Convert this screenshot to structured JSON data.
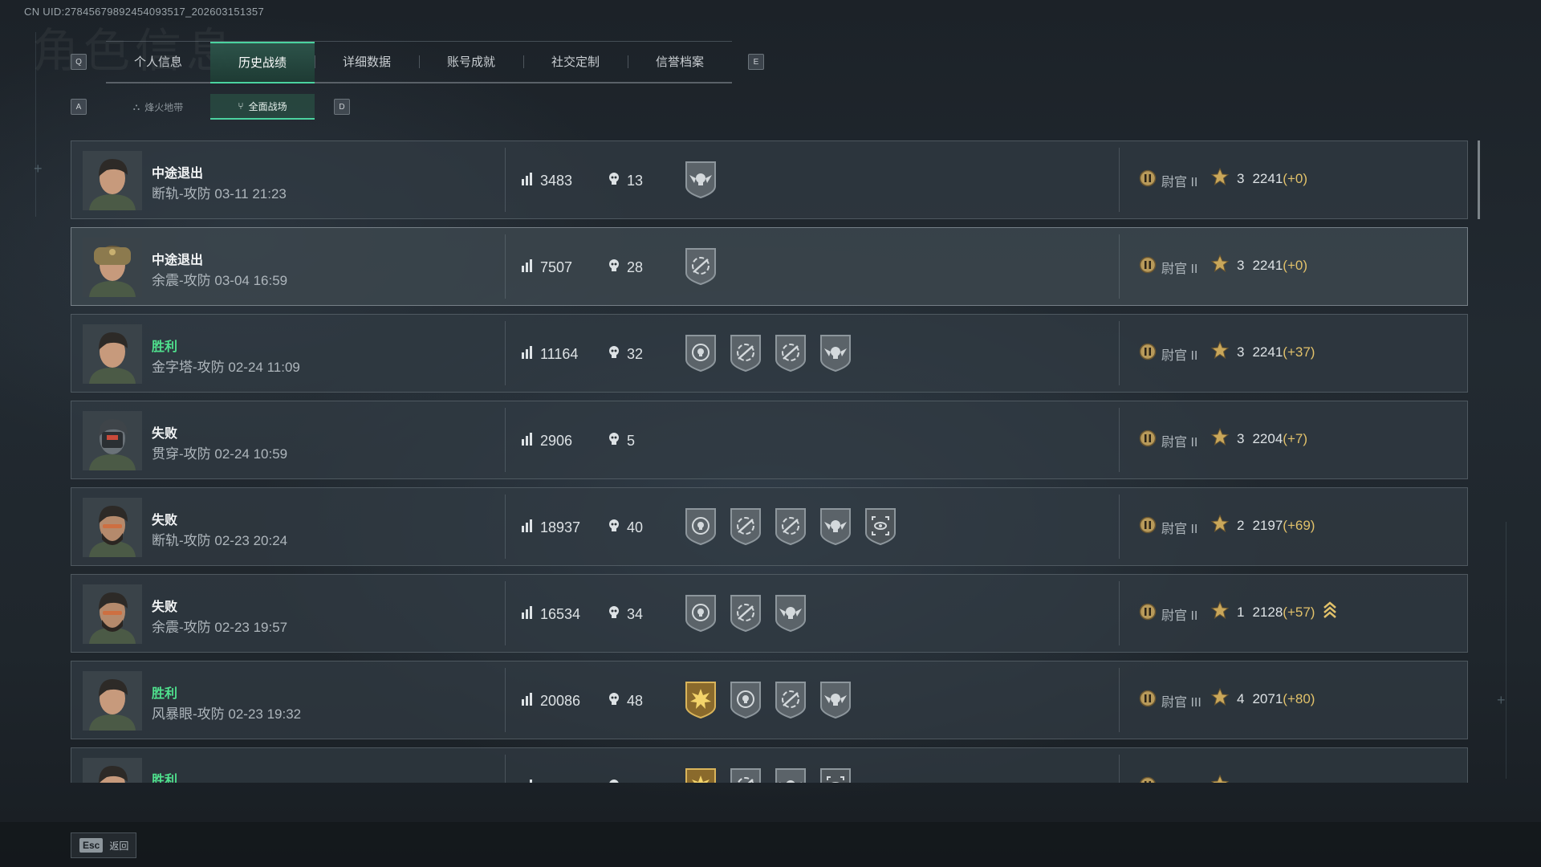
{
  "uid": "CN UID:27845679892454093517_202603151357",
  "bg_title": "角色信息",
  "tabs": {
    "key_left": "Q",
    "key_right": "E",
    "items": [
      "个人信息",
      "历史战绩",
      "详细数据",
      "账号成就",
      "社交定制",
      "信誉档案"
    ],
    "active_index": 1
  },
  "subtabs": {
    "key_left": "A",
    "key_right": "D",
    "items": [
      "烽火地带",
      "全面战场"
    ],
    "active_index": 1
  },
  "matches": [
    {
      "result": "中途退出",
      "win": false,
      "map": "断轨-攻防 03-11 21:23",
      "score": "3483",
      "kills": "13",
      "medals": [
        "skull-wings"
      ],
      "avatar": "female",
      "rank": "尉官 II",
      "stars": "3",
      "points": "2241",
      "delta": "(+0)"
    },
    {
      "result": "中途退出",
      "win": false,
      "map": "余震-攻防 03-04 16:59",
      "score": "7507",
      "kills": "28",
      "medals": [
        "target-rifle"
      ],
      "avatar": "helmet",
      "rank": "尉官 II",
      "stars": "3",
      "points": "2241",
      "delta": "(+0)"
    },
    {
      "result": "胜利",
      "win": true,
      "map": "金字塔-攻防 02-24 11:09",
      "score": "11164",
      "kills": "32",
      "medals": [
        "skull-target",
        "target-rifle",
        "target-rifle",
        "skull-wings"
      ],
      "avatar": "female",
      "rank": "尉官 II",
      "stars": "3",
      "points": "2241",
      "delta": "(+37)"
    },
    {
      "result": "失败",
      "win": false,
      "map": "贯穿-攻防 02-24 10:59",
      "score": "2906",
      "kills": "5",
      "medals": [],
      "avatar": "mask",
      "rank": "尉官 II",
      "stars": "3",
      "points": "2204",
      "delta": "(+7)"
    },
    {
      "result": "失败",
      "win": false,
      "map": "断轨-攻防 02-23 20:24",
      "score": "18937",
      "kills": "40",
      "medals": [
        "skull-target",
        "target-rifle",
        "target-rifle",
        "skull-wings",
        "eye-scope"
      ],
      "avatar": "bearded",
      "rank": "尉官 II",
      "stars": "2",
      "points": "2197",
      "delta": "(+69)"
    },
    {
      "result": "失败",
      "win": false,
      "map": "余震-攻防 02-23 19:57",
      "score": "16534",
      "kills": "34",
      "medals": [
        "skull-target",
        "target-rifle",
        "skull-wings"
      ],
      "avatar": "bearded",
      "rank": "尉官 II",
      "stars": "1",
      "points": "2128",
      "delta": "(+57)",
      "promo": true
    },
    {
      "result": "胜利",
      "win": true,
      "map": "风暴眼-攻防 02-23 19:32",
      "score": "20086",
      "kills": "48",
      "medals": [
        "gold-burst",
        "skull-target",
        "target-rifle",
        "skull-wings"
      ],
      "avatar": "female",
      "rank": "尉官 III",
      "stars": "4",
      "points": "2071",
      "delta": "(+80)"
    },
    {
      "result": "胜利",
      "win": true,
      "map": "",
      "score": "",
      "kills": "",
      "medals": [
        "gold-burst",
        "target-rifle",
        "skull-wings",
        "eye-scope"
      ],
      "avatar": "female",
      "rank": "",
      "stars": "",
      "points": "",
      "delta": ""
    }
  ],
  "footer": {
    "esc_key": "Esc",
    "esc_label": "返回"
  },
  "colors": {
    "accent": "#4bd3a0",
    "win": "#4fe08d",
    "delta": "#e1c16a",
    "rank_badge": "#b89a5a"
  }
}
